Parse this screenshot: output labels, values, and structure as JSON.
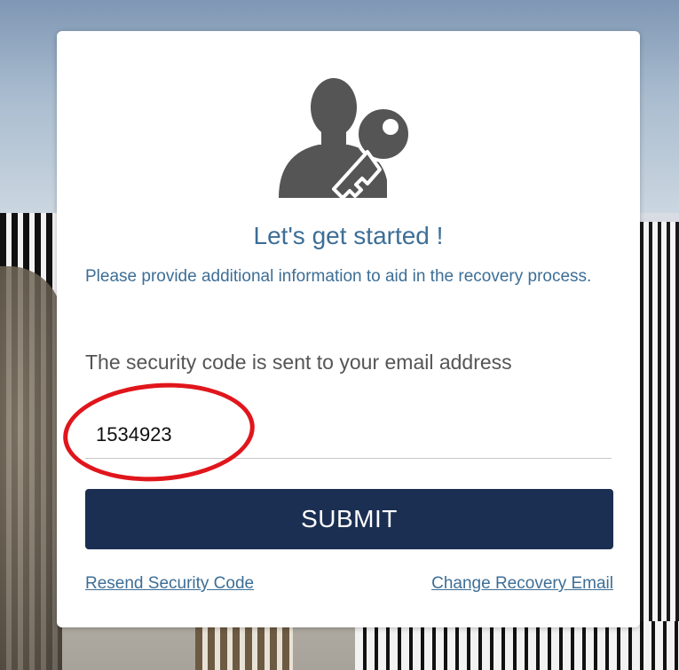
{
  "card": {
    "icon_name": "user-key-icon",
    "title": "Let's get started !",
    "subtitle": "Please provide additional information to aid in the recovery process.",
    "instruction": "The security code is sent to your email address",
    "security_code_value": "1534923",
    "submit_label": "SUBMIT",
    "resend_link": "Resend Security Code",
    "change_email_link": "Change Recovery Email"
  },
  "colors": {
    "accent_text": "#3d6e96",
    "button_bg": "#1b2f52",
    "annotation": "#e0161c"
  }
}
